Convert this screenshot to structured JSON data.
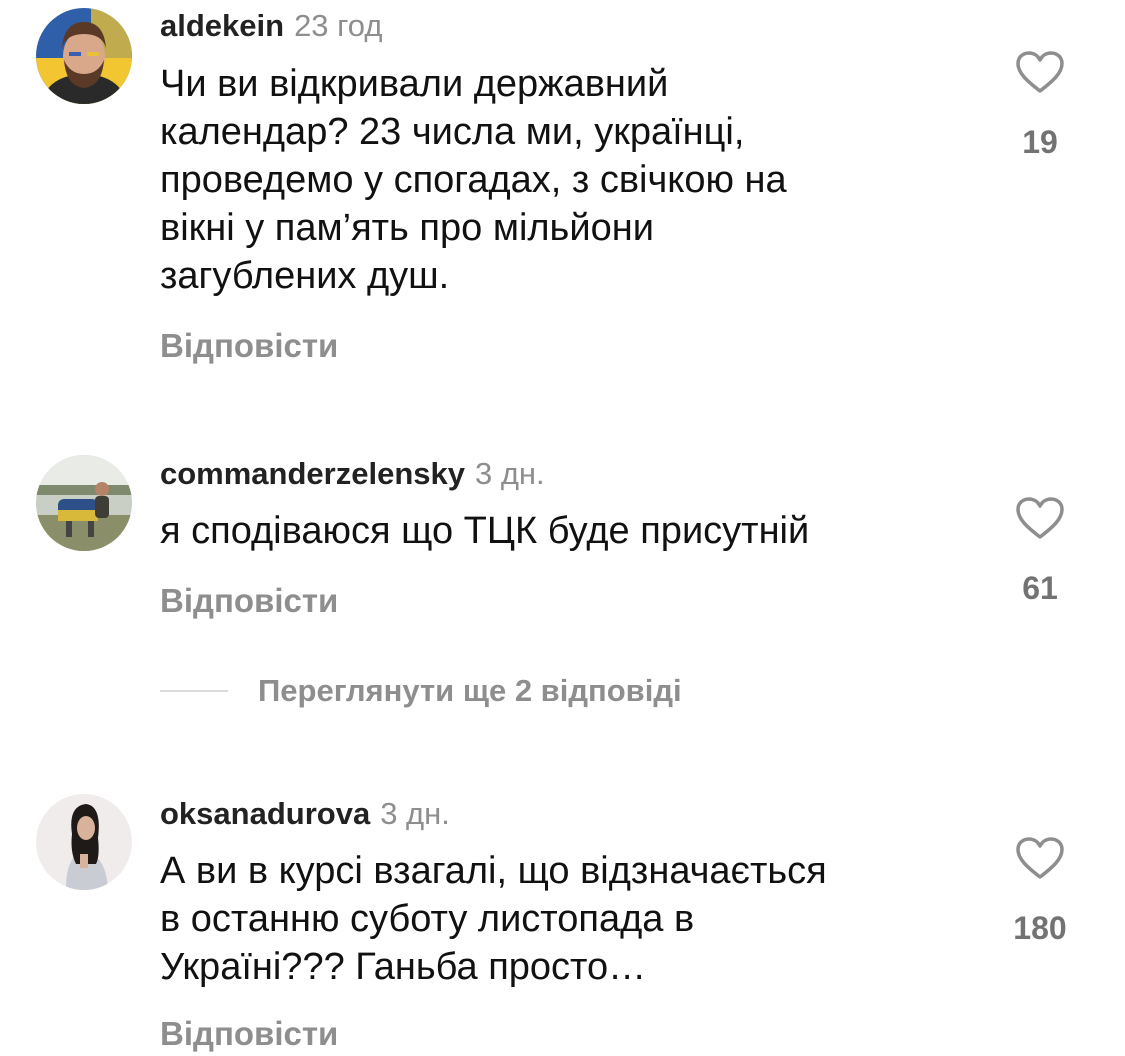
{
  "comments": [
    {
      "username": "aldekein",
      "time": "23 год",
      "text": "Чи ви відкривали державний\nкалендар? 23 числа ми, українці,\nпроведемо у спогадах, з свічкою на\nвікні у пам’ять про мільйони\nзагублених душ.",
      "reply_label": "Відповісти",
      "likes": "19",
      "avatar_icon": "avatar-bearded-man-ukraine-flag"
    },
    {
      "username": "commanderzelensky",
      "time": "3 дн.",
      "text": "я сподіваюся що ТЦК буде присутній",
      "reply_label": "Відповісти",
      "likes": "61",
      "avatar_icon": "avatar-man-outdoor-photo",
      "view_replies_label": "Переглянути ще 2 відповіді"
    },
    {
      "username": "oksanadurova",
      "time": "3 дн.",
      "text": "А ви в курсі взагалі, що відзначається\nв останню суботу листопада в\nУкраїні??? Ганьба просто…",
      "reply_label": "Відповісти",
      "likes": "180",
      "avatar_icon": "avatar-woman-dark-hair"
    }
  ],
  "colors": {
    "primary_text": "#111111",
    "secondary_text": "#8e8e8e",
    "like_count": "#737373",
    "divider": "#dbdbdb"
  }
}
